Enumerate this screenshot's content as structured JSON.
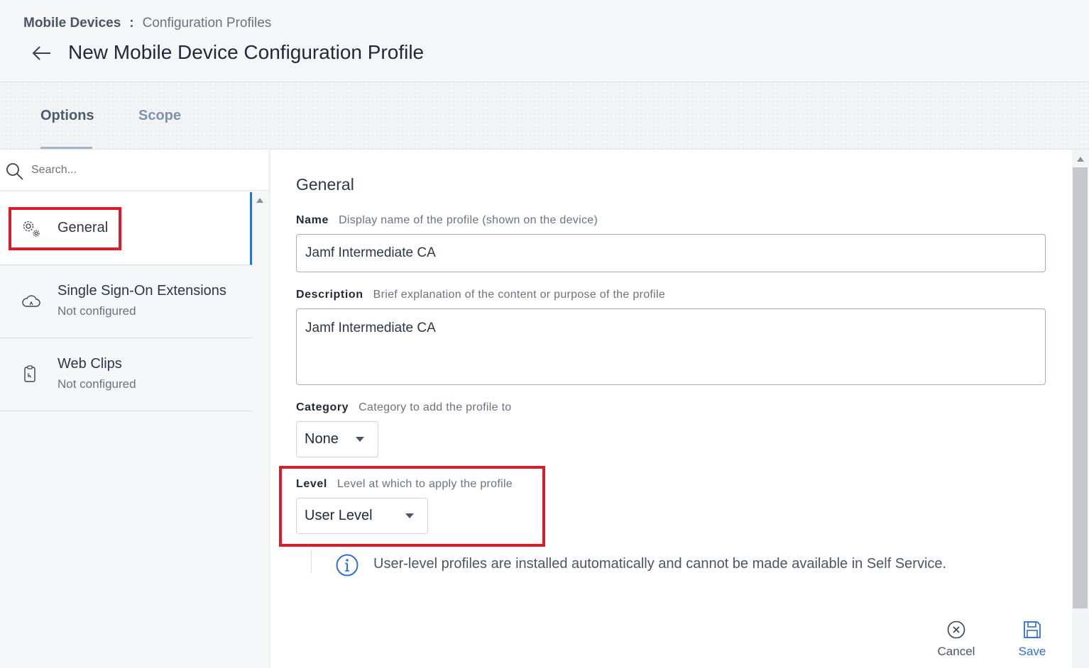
{
  "breadcrumb": {
    "root": "Mobile Devices",
    "separator": ":",
    "current": "Configuration Profiles"
  },
  "page": {
    "title": "New Mobile Device Configuration Profile"
  },
  "tabs": [
    {
      "label": "Options",
      "active": true
    },
    {
      "label": "Scope",
      "active": false
    }
  ],
  "sidebar": {
    "search_placeholder": "Search...",
    "items": [
      {
        "label": "General",
        "status": "",
        "icon": "gear-icon",
        "selected": true
      },
      {
        "label": "Single Sign-On Extensions",
        "status": "Not configured",
        "icon": "cloud-icon",
        "selected": false
      },
      {
        "label": "Web Clips",
        "status": "Not configured",
        "icon": "web-clip-icon",
        "selected": false
      }
    ]
  },
  "general": {
    "title": "General",
    "name": {
      "label": "Name",
      "hint": "Display name of the profile (shown on the device)",
      "value": "Jamf Intermediate CA"
    },
    "description": {
      "label": "Description",
      "hint": "Brief explanation of the content or purpose of the profile",
      "value": "Jamf Intermediate CA"
    },
    "category": {
      "label": "Category",
      "hint": "Category to add the profile to",
      "value": "None"
    },
    "level": {
      "label": "Level",
      "hint": "Level at which to apply the profile",
      "value": "User Level"
    },
    "info": "User-level profiles are installed automatically and cannot be made available in Self Service."
  },
  "actions": {
    "cancel": "Cancel",
    "save": "Save"
  },
  "colors": {
    "accent": "#2f6fd1",
    "highlight": "#dc1c2b"
  }
}
